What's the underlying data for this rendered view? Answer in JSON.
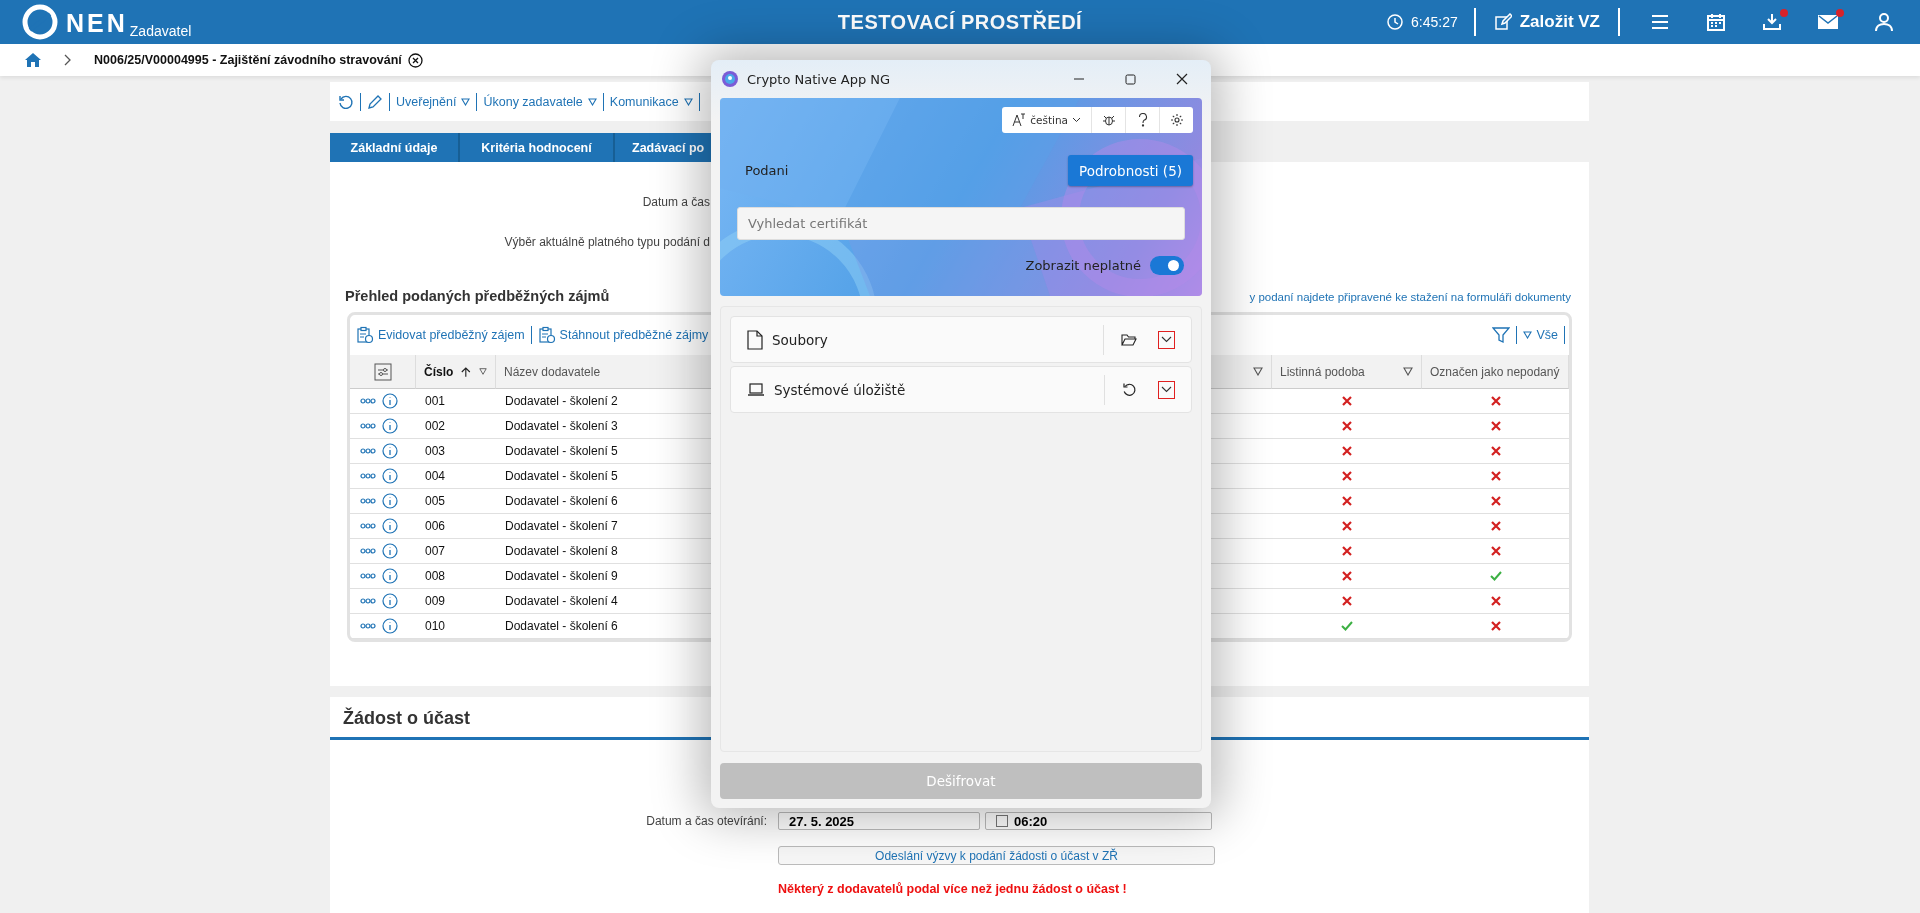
{
  "header": {
    "logo": "NEN",
    "subtitle": "Zadavatel",
    "environment": "TESTOVACÍ PROSTŘEDÍ",
    "time": "6:45:27",
    "create_button": "Založit VZ",
    "icons": [
      {
        "kind": "menu",
        "badge": false
      },
      {
        "kind": "calendar",
        "badge": false
      },
      {
        "kind": "download",
        "badge": true
      },
      {
        "kind": "mail",
        "badge": true
      },
      {
        "kind": "user",
        "badge": false
      }
    ]
  },
  "breadcrumb": {
    "title": "N006/25/V00004995 - Zajištění závodního stravování"
  },
  "toolbar": {
    "menus": [
      "Uveřejnění",
      "Úkony zadavatele",
      "Komunikace"
    ]
  },
  "tabs": [
    {
      "label": "Základní údaje",
      "selected": false
    },
    {
      "label": "Kritéria hodnocení",
      "selected": false
    },
    {
      "label": "Zadávací po",
      "selected": false
    }
  ],
  "form": {
    "labels": [
      "Datum a čas",
      "Výběr aktuálně platného typu podání d"
    ]
  },
  "interests": {
    "title": "Přehled podaných předběžných zájmů",
    "note_link": "y podaní najdete připravené ke stažení na formuláři dokumenty",
    "actions": [
      "Evidovat předběžný zájem",
      "Stáhnout předběžné zájmy"
    ],
    "filter_label": "Vše",
    "columns": [
      {
        "label": "Číslo",
        "sorted": true,
        "filter": true
      },
      {
        "label": "Název dodavatele",
        "sorted": false
      },
      {
        "sorted": false,
        "filter": true
      },
      {
        "label": "Listinná podoba",
        "sorted": false,
        "filter": true
      },
      {
        "label": "Označen jako nepodaný",
        "sorted": false
      }
    ],
    "rows": [
      {
        "number": "001",
        "supplier": "Dodavatel - školení 2",
        "paper": false,
        "marked_not_submitted": false
      },
      {
        "number": "002",
        "supplier": "Dodavatel - školení 3",
        "paper": false,
        "marked_not_submitted": false
      },
      {
        "number": "003",
        "supplier": "Dodavatel - školení 5",
        "paper": false,
        "marked_not_submitted": false
      },
      {
        "number": "004",
        "supplier": "Dodavatel - školení 5",
        "paper": false,
        "marked_not_submitted": false
      },
      {
        "number": "005",
        "supplier": "Dodavatel - školení 6",
        "paper": false,
        "marked_not_submitted": false
      },
      {
        "number": "006",
        "supplier": "Dodavatel - školení 7",
        "paper": false,
        "marked_not_submitted": false
      },
      {
        "number": "007",
        "supplier": "Dodavatel - školení 8",
        "paper": false,
        "marked_not_submitted": false
      },
      {
        "number": "008",
        "supplier": "Dodavatel - školení 9",
        "paper": false,
        "marked_not_submitted": true
      },
      {
        "number": "009",
        "supplier": "Dodavatel - školení 4",
        "paper": false,
        "marked_not_submitted": false
      },
      {
        "number": "010",
        "supplier": "Dodavatel - školení 6",
        "paper": true,
        "marked_not_submitted": false
      }
    ]
  },
  "participation": {
    "title": "Žádost o účast",
    "opening_label": "Datum a čas otevírání:",
    "date": "27. 5. 2025",
    "time": "06:20",
    "time_checked": false,
    "invite_button": "Odeslání výzvy k podání žádosti o účast v ZŘ",
    "warning": "Některý z dodavatelů podal více než jednu žádost o účast !"
  },
  "dialog": {
    "title": "Crypto Native App NG",
    "language": "čeština",
    "section_label": "Podani",
    "details_button": "Podrobnosti (5)",
    "search_placeholder": "Vyhledat certifikát",
    "show_invalid": {
      "label": "Zobrazit neplatné",
      "on": true
    },
    "sources": [
      {
        "kind": "files",
        "label": "Soubory",
        "highlighted": true
      },
      {
        "kind": "system",
        "label": "Systémové úložiště",
        "highlighted": true
      }
    ],
    "decrypt_button": {
      "label": "Dešifrovat",
      "disabled": true
    }
  }
}
